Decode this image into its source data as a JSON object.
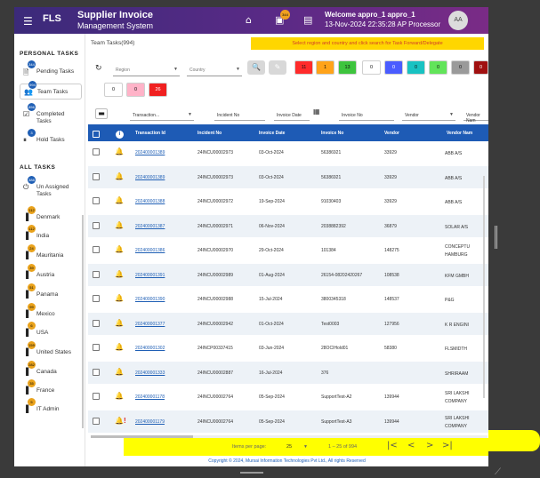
{
  "header": {
    "menu_icon": "☰",
    "logo": "FLS",
    "title": "Supplier Invoice",
    "subtitle": "Management System",
    "home_icon": "⌂",
    "inbox_icon": "▣",
    "notification_count": "344",
    "list_icon": "▤",
    "welcome": "Welcome appro_1 appro_1",
    "datetime": "13-Nov-2024 22:35:28 AP Processor",
    "avatar": "AA"
  },
  "sidebar": {
    "personal_heading": "PERSONAL TASKS",
    "personal_items": [
      {
        "label": "Pending Tasks",
        "badge": "344",
        "icon": "🗎"
      },
      {
        "label": "Team Tasks",
        "badge": "994",
        "icon": "👥"
      },
      {
        "label": "Completed Tasks",
        "badge": "856",
        "icon": "☑"
      },
      {
        "label": "Hold Tasks",
        "badge": "3",
        "icon": "⏸"
      }
    ],
    "all_heading": "ALL TASKS",
    "all_items": [
      {
        "label": "Un Assigned Tasks",
        "badge": "388",
        "icon": "⏻",
        "badge_color": "blue"
      },
      {
        "label": "Denmark",
        "badge": "112",
        "icon": "▐",
        "badge_color": "orange"
      },
      {
        "label": "India",
        "badge": "112",
        "icon": "▐",
        "badge_color": "orange"
      },
      {
        "label": "Mauritania",
        "badge": "24",
        "icon": "▐",
        "badge_color": "orange"
      },
      {
        "label": "Austria",
        "badge": "39",
        "icon": "▐",
        "badge_color": "orange"
      },
      {
        "label": "Panama",
        "badge": "51",
        "icon": "▐",
        "badge_color": "orange"
      },
      {
        "label": "Mexico",
        "badge": "99",
        "icon": "▐",
        "badge_color": "orange"
      },
      {
        "label": "USA",
        "badge": "6",
        "icon": "▐",
        "badge_color": "orange"
      },
      {
        "label": "United States",
        "badge": "159",
        "icon": "▐",
        "badge_color": "orange"
      },
      {
        "label": "Canada",
        "badge": "282",
        "icon": "▐",
        "badge_color": "orange"
      },
      {
        "label": "France",
        "badge": "35",
        "icon": "▐",
        "badge_color": "orange"
      },
      {
        "label": "IT Admin",
        "badge": "5",
        "icon": "▐",
        "badge_color": "orange"
      }
    ]
  },
  "content": {
    "title": "Team Tasks(994)",
    "banner": "Select region and country and click search for Task Forward/Delegate",
    "region_placeholder": "Region",
    "country_placeholder": "Country",
    "search_icon": "🔍",
    "clear_icon": "✎",
    "refresh_icon": "↻",
    "counters": [
      {
        "value": "11",
        "color": "#ff2b2b"
      },
      {
        "value": "1",
        "color": "#ffa31a"
      },
      {
        "value": "13",
        "color": "#3ec43e"
      },
      {
        "value": "0",
        "color": "#ffffff"
      },
      {
        "value": "0",
        "color": "#4a5cff"
      },
      {
        "value": "0",
        "color": "#18c2c2"
      },
      {
        "value": "0",
        "color": "#62e45a"
      },
      {
        "value": "0",
        "color": "#9a9a9a"
      },
      {
        "value": "0",
        "color": "#a01010"
      },
      {
        "value": "0",
        "color": "#ffffff"
      },
      {
        "value": "0",
        "color": "#ffb3c8"
      },
      {
        "value": "26",
        "color": "#f02020"
      }
    ]
  },
  "filters": {
    "transaction": "Transaction...",
    "incident": "Incident No",
    "invoice_date": "Invoice Date",
    "invoice_no": "Invoice No",
    "vendor": "Vendor",
    "vendor_name": "Vendor Nam",
    "tool_icon": "▬",
    "calendar_icon": "▦"
  },
  "table": {
    "headers": {
      "info": "i",
      "transaction_id": "Transaction Id",
      "incident_no": "Incident No",
      "invoice_date": "Invoice Date",
      "invoice_no": "Invoice No",
      "vendor": "Vendor",
      "vendor_name": "Vendor Nam"
    },
    "rows": [
      {
        "tx": "202400001389",
        "inc": "24INCU00002973",
        "date": "03-Oct-2024",
        "inv": "56386921",
        "vendor": "33929",
        "vname": "ABB A/S",
        "bell": "green"
      },
      {
        "tx": "202400001389",
        "inc": "24INCU00002973",
        "date": "03-Oct-2024",
        "inv": "56386921",
        "vendor": "33929",
        "vname": "ABB A/S",
        "bell": "green"
      },
      {
        "tx": "202400001388",
        "inc": "24INCU00002972",
        "date": "19-Sep-2024",
        "inv": "91030403",
        "vendor": "33929",
        "vname": "ABB A/S",
        "bell": "green"
      },
      {
        "tx": "202400001387",
        "inc": "24INCU00002971",
        "date": "06-Nov-2024",
        "inv": "2038882392",
        "vendor": "36879",
        "vname": "SOLAR A/S",
        "bell": "green"
      },
      {
        "tx": "202400001386",
        "inc": "24INCU00002970",
        "date": "29-Oct-2024",
        "inv": "101384",
        "vendor": "148275",
        "vname": "CONCEPTU HAMBURG",
        "bell": "green"
      },
      {
        "tx": "202400001391",
        "inc": "24INCU00002989",
        "date": "01-Aug-2024",
        "inv": "26154-08202420267",
        "vendor": "108538",
        "vname": "KFM GMBH",
        "bell": "green"
      },
      {
        "tx": "202400001390",
        "inc": "24INCU00002988",
        "date": "15-Jul-2024",
        "inv": "3800345318",
        "vendor": "148537",
        "vname": "P&G",
        "bell": "green"
      },
      {
        "tx": "202400001377",
        "inc": "24INCU00002942",
        "date": "01-Oct-2024",
        "inv": "Test0003",
        "vendor": "127956",
        "vname": "K R ENGINI",
        "bell": "green"
      },
      {
        "tx": "202400001302",
        "inc": "24INCP00337415",
        "date": "03-Jun-2024",
        "inv": "28OCIHold01",
        "vendor": "58380",
        "vname": "FLSMIDTH",
        "bell": "green"
      },
      {
        "tx": "202400001333",
        "inc": "24INCU00002887",
        "date": "16-Jul-2024",
        "inv": "376",
        "vendor": "",
        "vname": "SHRIRAAM",
        "bell": "green"
      },
      {
        "tx": "202400001178",
        "inc": "24INCU00002764",
        "date": "05-Sep-2024",
        "inv": "SupportTest-A2",
        "vendor": "139944",
        "vname": "SRI LAKSHI COMPANY",
        "bell": "green"
      },
      {
        "tx": "202400001179",
        "inc": "24INCU00002764",
        "date": "05-Sep-2024",
        "inv": "SupportTest-A3",
        "vendor": "139944",
        "vname": "SRI LAKSHI COMPANY",
        "bell": "red"
      }
    ]
  },
  "pager": {
    "items_per_page_label": "Items per page:",
    "items_per_page": "25",
    "range": "1 – 25 of 994",
    "first_icon": "|<",
    "prev_icon": "<",
    "next_icon": ">",
    "last_icon": ">|"
  },
  "footer": "Copyright © 2024, Mursai Information Technologies Pvt Ltd., All rights Reserved"
}
